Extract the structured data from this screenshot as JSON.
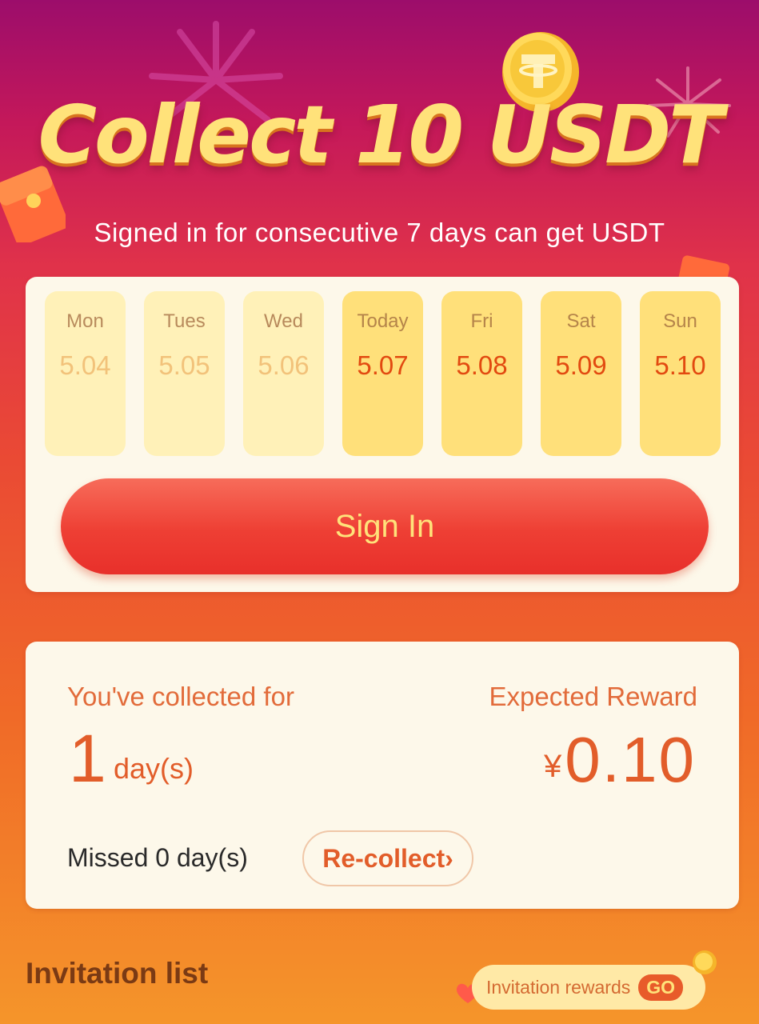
{
  "header": {
    "title": "Collect 10 USDT",
    "subtitle": "Signed in for consecutive 7 days can get USDT"
  },
  "week": {
    "days": [
      {
        "name": "Mon",
        "date": "5.04",
        "state": "past"
      },
      {
        "name": "Tues",
        "date": "5.05",
        "state": "past"
      },
      {
        "name": "Wed",
        "date": "5.06",
        "state": "past"
      },
      {
        "name": "Today",
        "date": "5.07",
        "state": "future"
      },
      {
        "name": "Fri",
        "date": "5.08",
        "state": "future"
      },
      {
        "name": "Sat",
        "date": "5.09",
        "state": "future"
      },
      {
        "name": "Sun",
        "date": "5.10",
        "state": "future"
      }
    ],
    "sign_in_label": "Sign In"
  },
  "stats": {
    "collected_label": "You've collected for",
    "collected_count": "1",
    "collected_unit": "day(s)",
    "reward_label": "Expected Reward",
    "reward_currency": "¥",
    "reward_value": "0.10",
    "missed_text": "Missed 0 day(s)",
    "recollect_label": "Re-collect›"
  },
  "invitation": {
    "title": "Invitation list",
    "rewards_label": "Invitation rewards",
    "go_label": "GO"
  },
  "colors": {
    "accent_yellow": "#ffe27a",
    "accent_red": "#e8302b",
    "accent_orange": "#e25d2a"
  }
}
